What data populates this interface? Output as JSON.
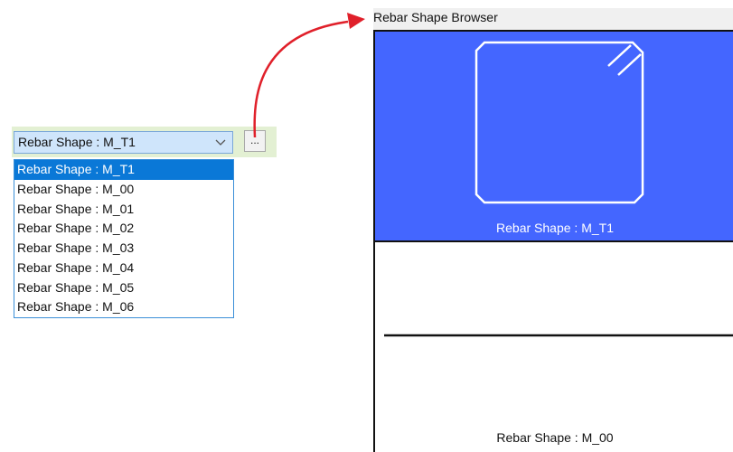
{
  "combo": {
    "selected_value": "Rebar Shape : M_T1",
    "browse_button_label": "..."
  },
  "dropdown": {
    "items": [
      "Rebar Shape : M_T1",
      "Rebar Shape : M_00",
      "Rebar Shape : M_01",
      "Rebar Shape : M_02",
      "Rebar Shape : M_03",
      "Rebar Shape : M_04",
      "Rebar Shape : M_05",
      "Rebar Shape : M_06"
    ],
    "selected_index": 0
  },
  "browser": {
    "title": "Rebar Shape Browser",
    "tiles": [
      {
        "label": "Rebar Shape : M_T1",
        "selected": true,
        "shape": "stirrup-rectangle-with-hook"
      },
      {
        "label": "Rebar Shape : M_00",
        "selected": false,
        "shape": "straight-bar"
      }
    ]
  },
  "colors": {
    "selection_blue": "#0a78d7",
    "tile_selected_bg": "#4466ff",
    "arrow_red": "#e0202a",
    "combo_bg": "#cfe5fb",
    "strip_bg": "#e3f0d3"
  },
  "icons": {
    "combo_chevron": "chevron-down-icon",
    "arrow": "red-curved-arrow-icon"
  }
}
